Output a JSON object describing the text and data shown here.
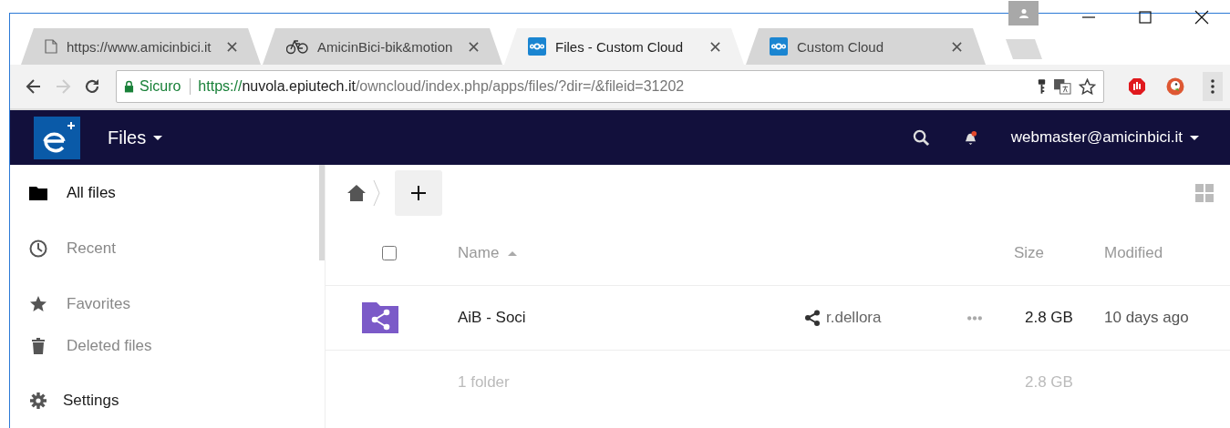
{
  "browser": {
    "tabs": [
      {
        "title": "https://www.amicinbici.it",
        "selected": false
      },
      {
        "title": "AmicinBici-bik&motion",
        "selected": false
      },
      {
        "title": "Files - Custom Cloud",
        "selected": true
      },
      {
        "title": "Custom Cloud",
        "selected": false
      }
    ],
    "security_label": "Sicuro",
    "url": {
      "scheme": "https://",
      "host": "nuvola.epiutech.it",
      "path": "/owncloud/index.php/apps/files/?dir=/&fileid=31202"
    }
  },
  "header": {
    "app_menu": "Files",
    "user_menu": "webmaster@amicinbici.it",
    "notification_unread": true
  },
  "sidebar": {
    "items": [
      {
        "label": "All files",
        "selected": true
      },
      {
        "label": "Recent",
        "selected": false
      },
      {
        "label": "Favorites",
        "selected": false
      },
      {
        "label": "Deleted files",
        "selected": false
      }
    ],
    "settings": "Settings"
  },
  "files": {
    "select_all": {
      "checked": false
    },
    "columns": [
      {
        "label": "Name",
        "sorted": true
      },
      {
        "label": "Size",
        "sorted": false
      },
      {
        "label": "Modified",
        "sorted": false
      }
    ],
    "rows": [
      {
        "name": "AiB - Soci",
        "kind": "shared-folder",
        "shared_with": "r.dellora",
        "size": "2.8 GB",
        "modified": "10 days ago"
      }
    ],
    "summary": {
      "count": "1 folder",
      "size": "2.8 GB"
    }
  }
}
